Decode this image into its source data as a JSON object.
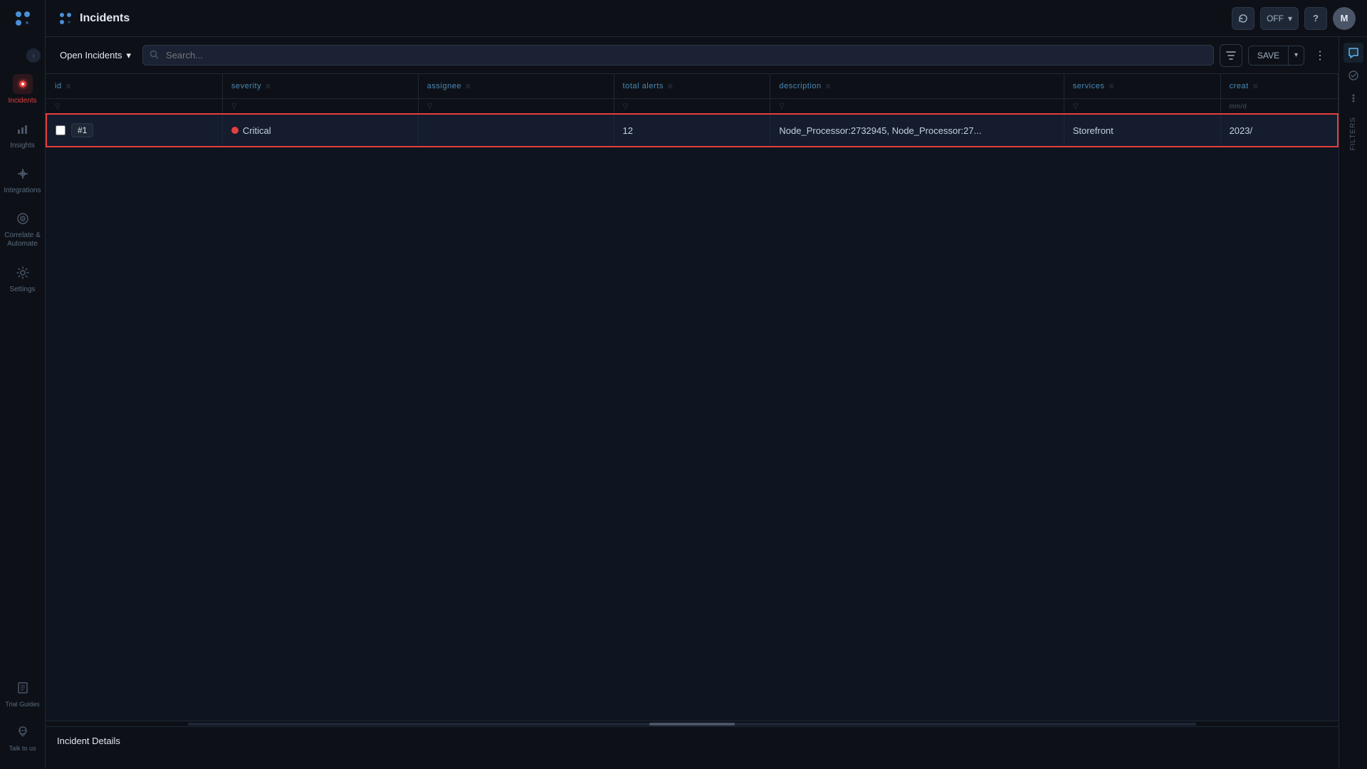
{
  "app": {
    "title": "Incidents",
    "logo_icon": "🐾"
  },
  "topbar": {
    "refresh_label": "↻",
    "toggle_label": "OFF",
    "toggle_dropdown": "▾",
    "help_label": "?",
    "avatar_label": "M"
  },
  "sidebar": {
    "collapse_icon": "›",
    "items": [
      {
        "id": "incidents",
        "label": "Incidents",
        "icon": "🔴",
        "active": true
      },
      {
        "id": "insights",
        "label": "Insights",
        "icon": "📊",
        "active": false
      },
      {
        "id": "integrations",
        "label": "Integrations",
        "icon": "⚡",
        "active": false
      },
      {
        "id": "correlate",
        "label": "Correlate &\nAutomate",
        "icon": "⊙",
        "active": false
      },
      {
        "id": "settings",
        "label": "Settings",
        "icon": "⚙",
        "active": false
      }
    ],
    "bottom_items": [
      {
        "id": "trial-guides",
        "label": "Trial Guides",
        "icon": "🧭"
      },
      {
        "id": "talk-to-us",
        "label": "Talk to us",
        "icon": "💬"
      }
    ]
  },
  "toolbar": {
    "open_incidents_label": "Open Incidents",
    "dropdown_arrow": "▾",
    "search_placeholder": "Search...",
    "save_label": "SAVE",
    "dropdown_label": "▾",
    "more_label": "⋮"
  },
  "table": {
    "columns": [
      {
        "key": "id",
        "label": "id"
      },
      {
        "key": "severity",
        "label": "severity"
      },
      {
        "key": "assignee",
        "label": "assignee"
      },
      {
        "key": "total_alerts",
        "label": "total alerts"
      },
      {
        "key": "description",
        "label": "description"
      },
      {
        "key": "services",
        "label": "services"
      },
      {
        "key": "created",
        "label": "creat"
      }
    ],
    "rows": [
      {
        "id": "#1",
        "severity": "Critical",
        "severity_level": "critical",
        "assignee": "",
        "total_alerts": "12",
        "description": "Node_Processor:2732945, Node_Processor:27...",
        "services": "Storefront",
        "created": "2023/",
        "selected": true
      }
    ]
  },
  "right_panel": {
    "filters_label": "FILTERS",
    "chat_icon": "💬",
    "check_icon": "✓",
    "dot_icon": "•"
  },
  "incident_details": {
    "title": "Incident Details"
  },
  "scrollbar": {
    "thumb_color": "#4a5568"
  }
}
